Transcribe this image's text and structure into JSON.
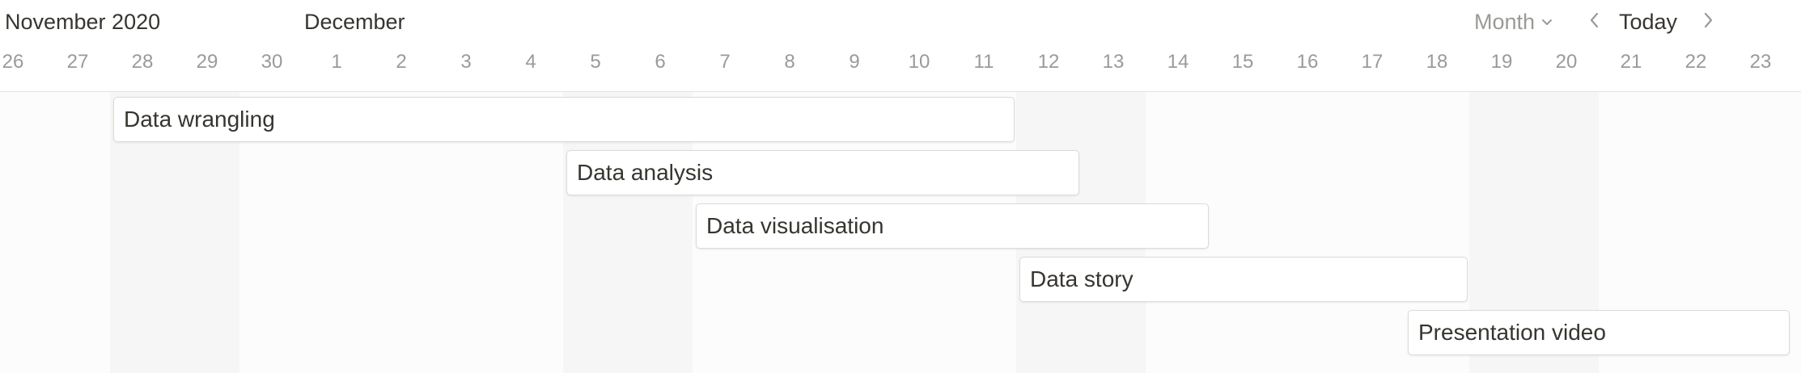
{
  "header": {
    "current_month": "November 2020",
    "next_month": "December",
    "view_mode": "Month",
    "today_label": "Today"
  },
  "days": [
    "26",
    "27",
    "28",
    "29",
    "30",
    "1",
    "2",
    "3",
    "4",
    "5",
    "6",
    "7",
    "8",
    "9",
    "10",
    "11",
    "12",
    "13",
    "14",
    "15",
    "16",
    "17",
    "18",
    "19",
    "20",
    "21",
    "22",
    "23"
  ],
  "tasks": [
    {
      "label": "Data wrangling",
      "start": "Nov 28",
      "end": "Dec 11"
    },
    {
      "label": "Data analysis",
      "start": "Dec 5",
      "end": "Dec 12"
    },
    {
      "label": "Data visualisation",
      "start": "Dec 7",
      "end": "Dec 14"
    },
    {
      "label": "Data story",
      "start": "Dec 12",
      "end": "Dec 18"
    },
    {
      "label": "Presentation video",
      "start": "Dec 18",
      "end": "Dec 23"
    }
  ],
  "icons": {
    "view_dropdown": "chevron-down-icon",
    "previous": "chevron-left-icon",
    "next": "chevron-right-icon"
  },
  "colors": {
    "text": "#37352f",
    "muted_text": "#9b9a97",
    "weekend_shade": "#f6f6f6",
    "bar_border": "#dcdbd8"
  }
}
